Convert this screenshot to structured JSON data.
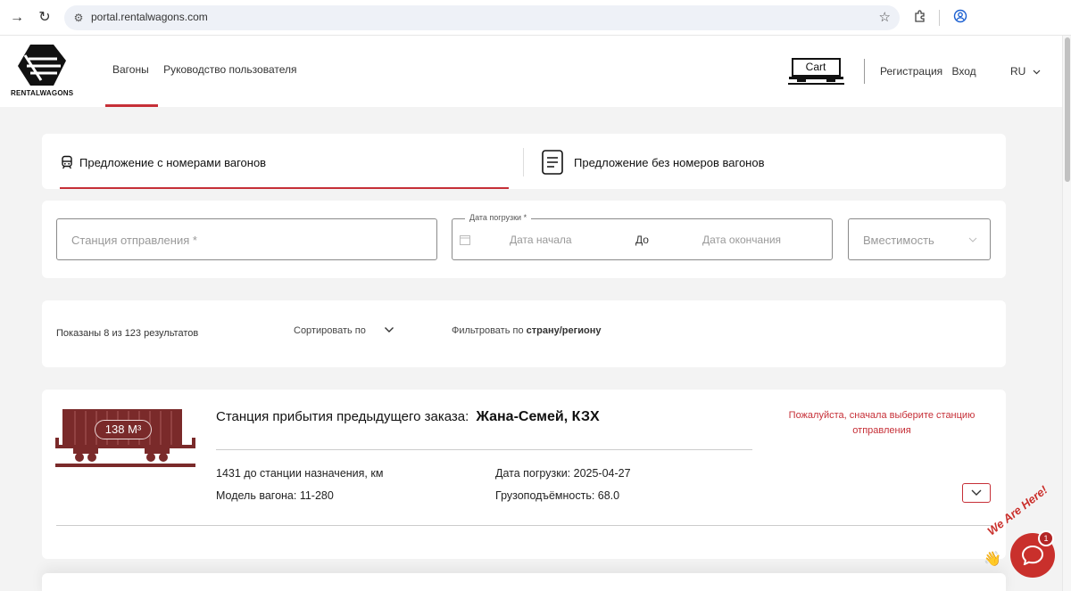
{
  "browser": {
    "url": "portal.rentalwagons.com"
  },
  "site": {
    "logo_text": "RENTALWAGONS",
    "nav": [
      "Вагоны",
      "Руководство пользователя"
    ],
    "cart_label": "Cart",
    "register": "Регистрация",
    "login": "Вход",
    "language": "RU"
  },
  "tabs": [
    {
      "label": "Предложение с номерами вагонов",
      "active": true
    },
    {
      "label": "Предложение без номеров вагонов",
      "active": false
    }
  ],
  "search": {
    "station_placeholder": "Станция отправления *",
    "date_legend": "Дата погрузки *",
    "date_start_placeholder": "Дата начала",
    "date_to": "До",
    "date_end_placeholder": "Дата окончания",
    "capacity_placeholder": "Вместимость"
  },
  "filters": {
    "results_count": "Показаны 8 из 123 результатов",
    "sort_label": "Сортировать по",
    "filter_prefix": "Фильтровать по",
    "filter_bold": "страну/регионy"
  },
  "result": {
    "volume": "138 M³",
    "title_label": "Станция прибытия предыдущего заказа:",
    "title_value": "Жана-Семей, КЗХ",
    "distance": "1431 до станции назначения, км",
    "model": "Модель вагона: 11-280",
    "load_date": "Дата погрузки: 2025-04-27",
    "capacity": "Грузоподъёмность: 68.0",
    "warning": "Пожалуйста, сначала выберите станцию отправления"
  },
  "chat": {
    "badge": "1",
    "tagline": "We Are Here!"
  },
  "colors": {
    "accent": "#c62f37",
    "wagon": "#7a2a2a"
  }
}
